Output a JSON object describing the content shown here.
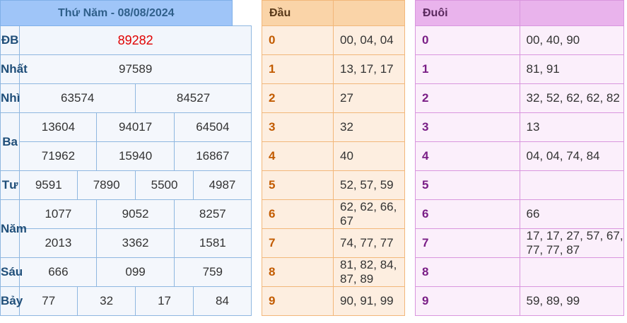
{
  "results": {
    "title": "Thứ Năm - 08/08/2024",
    "rows": {
      "db": {
        "label": "ĐB",
        "values": [
          "89282"
        ]
      },
      "nhat": {
        "label": "Nhất",
        "values": [
          "97589"
        ]
      },
      "nhi": {
        "label": "Nhì",
        "values": [
          "63574",
          "84527"
        ]
      },
      "ba": {
        "label": "Ba",
        "values": [
          "13604",
          "94017",
          "64504",
          "71962",
          "15940",
          "16867"
        ]
      },
      "tu": {
        "label": "Tư",
        "values": [
          "9591",
          "7890",
          "5500",
          "4987"
        ]
      },
      "nam": {
        "label": "Năm",
        "values": [
          "1077",
          "9052",
          "8257",
          "2013",
          "3362",
          "1581"
        ]
      },
      "sau": {
        "label": "Sáu",
        "values": [
          "666",
          "099",
          "759"
        ]
      },
      "bay": {
        "label": "Bảy",
        "values": [
          "77",
          "32",
          "17",
          "84"
        ]
      }
    }
  },
  "heads": {
    "title": "Đầu",
    "rows": [
      {
        "key": "0",
        "value": "00, 04, 04"
      },
      {
        "key": "1",
        "value": "13, 17, 17"
      },
      {
        "key": "2",
        "value": "27"
      },
      {
        "key": "3",
        "value": "32"
      },
      {
        "key": "4",
        "value": "40"
      },
      {
        "key": "5",
        "value": "52, 57, 59"
      },
      {
        "key": "6",
        "value": "62, 62, 66, 67"
      },
      {
        "key": "7",
        "value": "74, 77, 77"
      },
      {
        "key": "8",
        "value": "81, 82, 84, 87, 89"
      },
      {
        "key": "9",
        "value": "90, 91, 99"
      }
    ]
  },
  "tails": {
    "title": "Đuôi",
    "rows": [
      {
        "key": "0",
        "value": "00, 40, 90"
      },
      {
        "key": "1",
        "value": "81, 91"
      },
      {
        "key": "2",
        "value": "32, 52, 62, 62, 82"
      },
      {
        "key": "3",
        "value": "13"
      },
      {
        "key": "4",
        "value": "04, 04, 74, 84"
      },
      {
        "key": "5",
        "value": ""
      },
      {
        "key": "6",
        "value": "66"
      },
      {
        "key": "7",
        "value": "17, 17, 27, 57, 67, 77, 77, 87"
      },
      {
        "key": "8",
        "value": ""
      },
      {
        "key": "9",
        "value": "59, 89, 99"
      }
    ]
  }
}
